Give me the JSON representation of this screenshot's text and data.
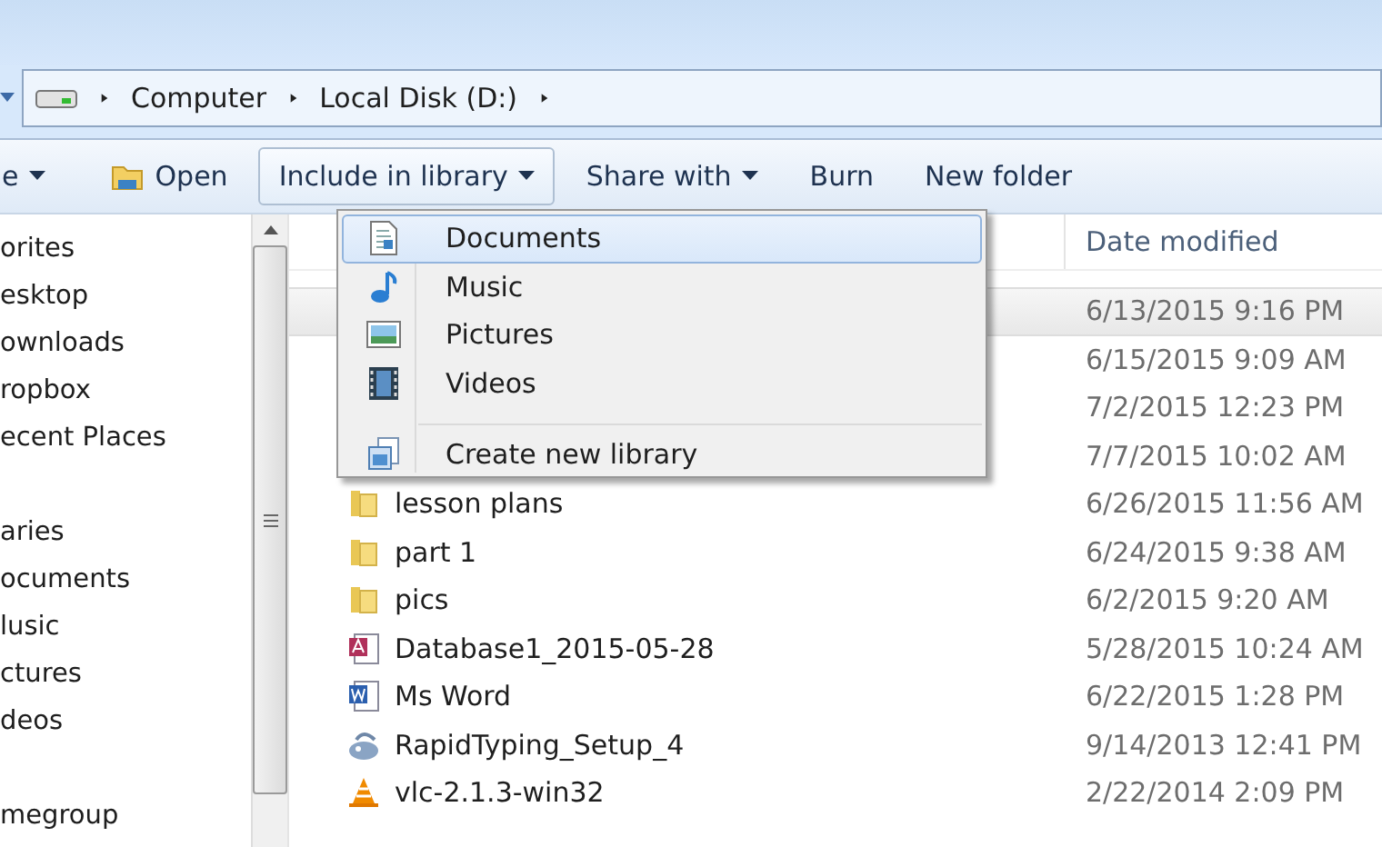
{
  "address_bar": {
    "crumbs": [
      {
        "label": "Computer"
      },
      {
        "label": "Local Disk (D:)"
      }
    ]
  },
  "toolbar": {
    "items": [
      {
        "kind": "menu",
        "label": "e",
        "selected": false
      },
      {
        "kind": "open",
        "label": "Open",
        "selected": false
      },
      {
        "kind": "menu",
        "label": "Include in library",
        "selected": true
      },
      {
        "kind": "menu",
        "label": "Share with",
        "selected": false
      },
      {
        "kind": "plain",
        "label": "Burn",
        "selected": false
      },
      {
        "kind": "plain",
        "label": "New folder",
        "selected": false
      }
    ]
  },
  "nav_pane": {
    "groups": [
      {
        "items": [
          "orites",
          "esktop",
          "ownloads",
          "ropbox",
          "ecent Places"
        ]
      },
      {
        "items": [
          "aries",
          "ocuments",
          "lusic",
          "ctures",
          "deos"
        ]
      },
      {
        "items": [
          "megroup"
        ]
      }
    ]
  },
  "file_list": {
    "columns": [
      {
        "label": "Date modified"
      }
    ],
    "rows": [
      {
        "date": "6/13/2015 9:16 PM",
        "selected": true
      },
      {
        "date": "6/15/2015 9:09 AM",
        "selected": false
      },
      {
        "date": "7/2/2015 12:23 PM",
        "selected": false
      },
      {
        "date": "7/7/2015 10:02 AM",
        "selected": false
      },
      {
        "kind": "folder",
        "name": "lesson plans",
        "date": "6/26/2015 11:56 AM",
        "selected": false
      },
      {
        "kind": "folder",
        "name": "part 1",
        "date": "6/24/2015 9:38 AM",
        "selected": false
      },
      {
        "kind": "folder",
        "name": "pics",
        "date": "6/2/2015 9:20 AM",
        "selected": false
      },
      {
        "kind": "access",
        "name": "Database1_2015-05-28",
        "date": "5/28/2015 10:24 AM",
        "selected": false
      },
      {
        "kind": "word",
        "name": "Ms Word",
        "date": "6/22/2015 1:28 PM",
        "selected": false
      },
      {
        "kind": "setup",
        "name": "RapidTyping_Setup_4",
        "date": "9/14/2013 12:41 PM",
        "selected": false
      },
      {
        "kind": "vlc",
        "name": "vlc-2.1.3-win32",
        "date": "2/22/2014 2:09 PM",
        "selected": false
      }
    ]
  },
  "library_menu": {
    "items": [
      {
        "kind": "documents",
        "label": "Documents",
        "selected": true
      },
      {
        "kind": "music",
        "label": "Music",
        "selected": false
      },
      {
        "kind": "pictures",
        "label": "Pictures",
        "selected": false
      },
      {
        "kind": "videos",
        "label": "Videos",
        "selected": false
      },
      {
        "kind": "new-library",
        "label": "Create new library",
        "selected": false
      }
    ]
  }
}
